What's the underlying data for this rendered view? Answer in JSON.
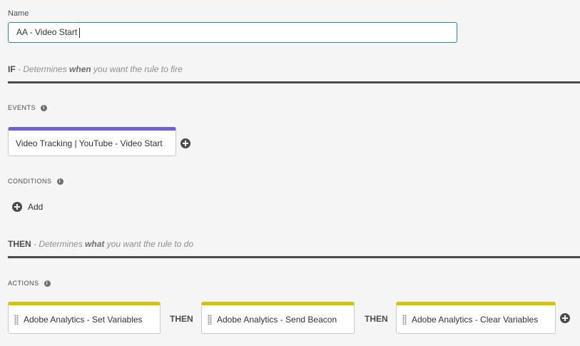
{
  "name_field": {
    "label": "Name",
    "value": "AA - Video Start"
  },
  "if_section": {
    "keyword": "IF",
    "desc_prefix": " - Determines ",
    "desc_emphasis": "when",
    "desc_suffix": " you want the rule to fire"
  },
  "events": {
    "label": "EVENTS",
    "items": [
      "Video Tracking | YouTube - Video Start"
    ]
  },
  "conditions": {
    "label": "CONDITIONS",
    "add_label": "Add"
  },
  "then_section": {
    "keyword": "THEN",
    "desc_prefix": " - Determines ",
    "desc_emphasis": "what",
    "desc_suffix": " you want the rule to do"
  },
  "actions": {
    "label": "ACTIONS",
    "separator": "THEN",
    "items": [
      "Adobe Analytics - Set Variables",
      "Adobe Analytics - Send Beacon",
      "Adobe Analytics - Clear Variables"
    ]
  },
  "colors": {
    "event_accent": "#6e60d9",
    "action_accent": "#d7c100",
    "input_focus": "#2680eb"
  },
  "icons": {
    "info": "info-icon",
    "add": "plus-circle-icon",
    "drag": "drag-handle-icon"
  }
}
